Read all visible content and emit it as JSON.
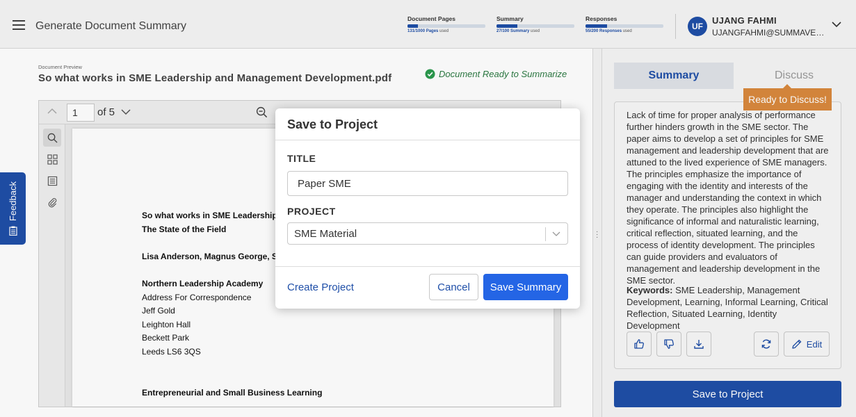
{
  "header": {
    "app_title": "Generate Document Summary",
    "usage": [
      {
        "label": "Document Pages",
        "count": "131/1000 Pages",
        "suffix": "used",
        "fraction": 0.131
      },
      {
        "label": "Summary",
        "count": "27/100 Summary",
        "suffix": "used",
        "fraction": 0.27
      },
      {
        "label": "Responses",
        "count": "55/200 Responses",
        "suffix": "used",
        "fraction": 0.275
      }
    ],
    "user": {
      "initials": "UF",
      "name": "UJANG FAHMI",
      "email": "UJANGFAHMI@SUMMAVERSE.COM"
    }
  },
  "document": {
    "preview_label": "Document Preview",
    "filename": "So what works in SME Leadership and Management Development.pdf",
    "status": "Document Ready to Summarize",
    "viewer": {
      "current_page": "1",
      "page_of": "of 5"
    },
    "pdf_lines": [
      {
        "text": "So what works in SME Leadership a",
        "bold": true
      },
      {
        "text": "The State of the Field",
        "bold": true
      },
      {
        "text": "Lisa Anderson, Magnus George, Ste",
        "bold": true
      },
      {
        "text": "Northern Leadership Academy",
        "bold": true
      },
      {
        "text": "Address For Correspondence",
        "bold": false
      },
      {
        "text": "Jeff Gold",
        "bold": false
      },
      {
        "text": "Leighton Hall",
        "bold": false
      },
      {
        "text": "Beckett Park",
        "bold": false
      },
      {
        "text": "Leeds LS6 3QS",
        "bold": false
      },
      {
        "text": "Entrepreneurial and Small Business Learning",
        "bold": true
      }
    ]
  },
  "right_panel": {
    "tabs": {
      "summary": "Summary",
      "discuss": "Discuss"
    },
    "tooltip": "Ready to Discuss!",
    "summary_text": "Lack of time for proper analysis of performance further hinders growth in the SME sector. The paper aims to develop a set of principles for SME management and leadership development that are attuned to the lived experience of SME managers. The principles emphasize the importance of engaging with the identity and interests of the manager and understanding the context in which they operate. The principles also highlight the significance of informal and naturalistic learning, critical reflection, situated learning, and the process of identity development. The principles can guide providers and evaluators of management and leadership development in the SME sector.",
    "keywords_label": "Keywords:",
    "keywords": "SME Leadership, Management Development, Learning, Informal Learning, Critical Reflection, Situated Learning, Identity Development",
    "edit_label": "Edit",
    "save_to_project": "Save to Project"
  },
  "feedback": {
    "label": "Feedback"
  },
  "modal": {
    "title": "Save to Project",
    "title_field_label": "TITLE",
    "title_value": "Paper SME",
    "project_field_label": "PROJECT",
    "project_value": "SME Material",
    "create_project": "Create Project",
    "cancel": "Cancel",
    "save_summary": "Save Summary"
  },
  "colors": {
    "brand": "#1f4fa8",
    "primary_button": "#2465e5",
    "success": "#2c7a43",
    "tooltip": "#d9893d"
  }
}
